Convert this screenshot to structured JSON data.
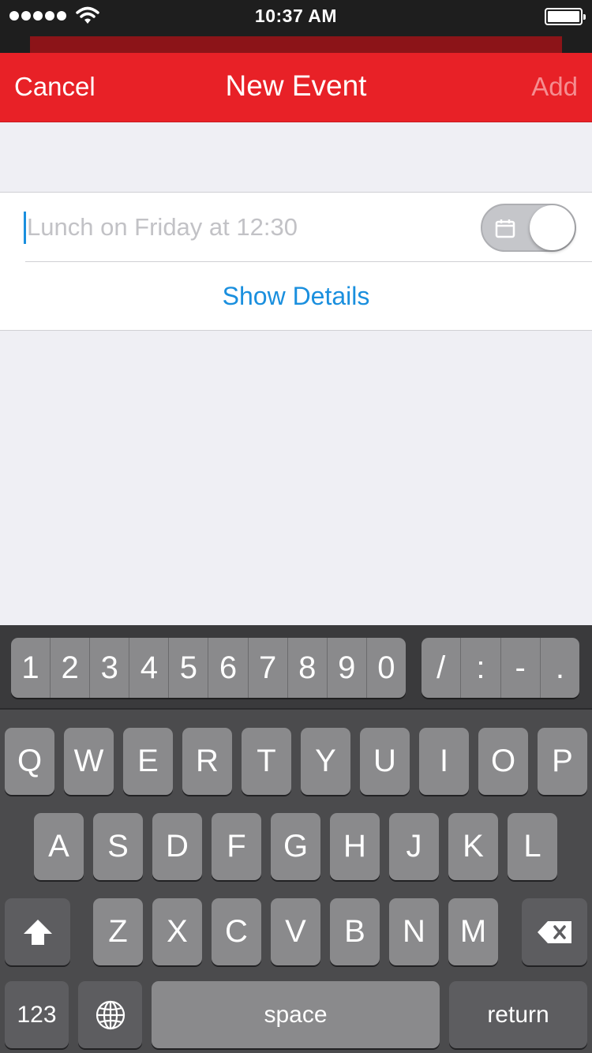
{
  "status_bar": {
    "time": "10:37 AM"
  },
  "nav": {
    "cancel_label": "Cancel",
    "title": "New Event",
    "add_label": "Add"
  },
  "form": {
    "event_placeholder": "Lunch on Friday at 12:30",
    "event_value": "",
    "calendar_toggle_on": true,
    "show_details_label": "Show Details"
  },
  "keyboard": {
    "number_keys": [
      "1",
      "2",
      "3",
      "4",
      "5",
      "6",
      "7",
      "8",
      "9",
      "0"
    ],
    "symbol_keys": [
      "/",
      ":",
      "-",
      "."
    ],
    "row1": [
      "Q",
      "W",
      "E",
      "R",
      "T",
      "Y",
      "U",
      "I",
      "O",
      "P"
    ],
    "row2": [
      "A",
      "S",
      "D",
      "F",
      "G",
      "H",
      "J",
      "K",
      "L"
    ],
    "row3": [
      "Z",
      "X",
      "C",
      "V",
      "B",
      "N",
      "M"
    ],
    "mode_label": "123",
    "space_label": "space",
    "return_label": "return"
  },
  "colors": {
    "nav_red": "#e82127",
    "accent_blue": "#1a8fde",
    "add_disabled": "#f58d90"
  }
}
